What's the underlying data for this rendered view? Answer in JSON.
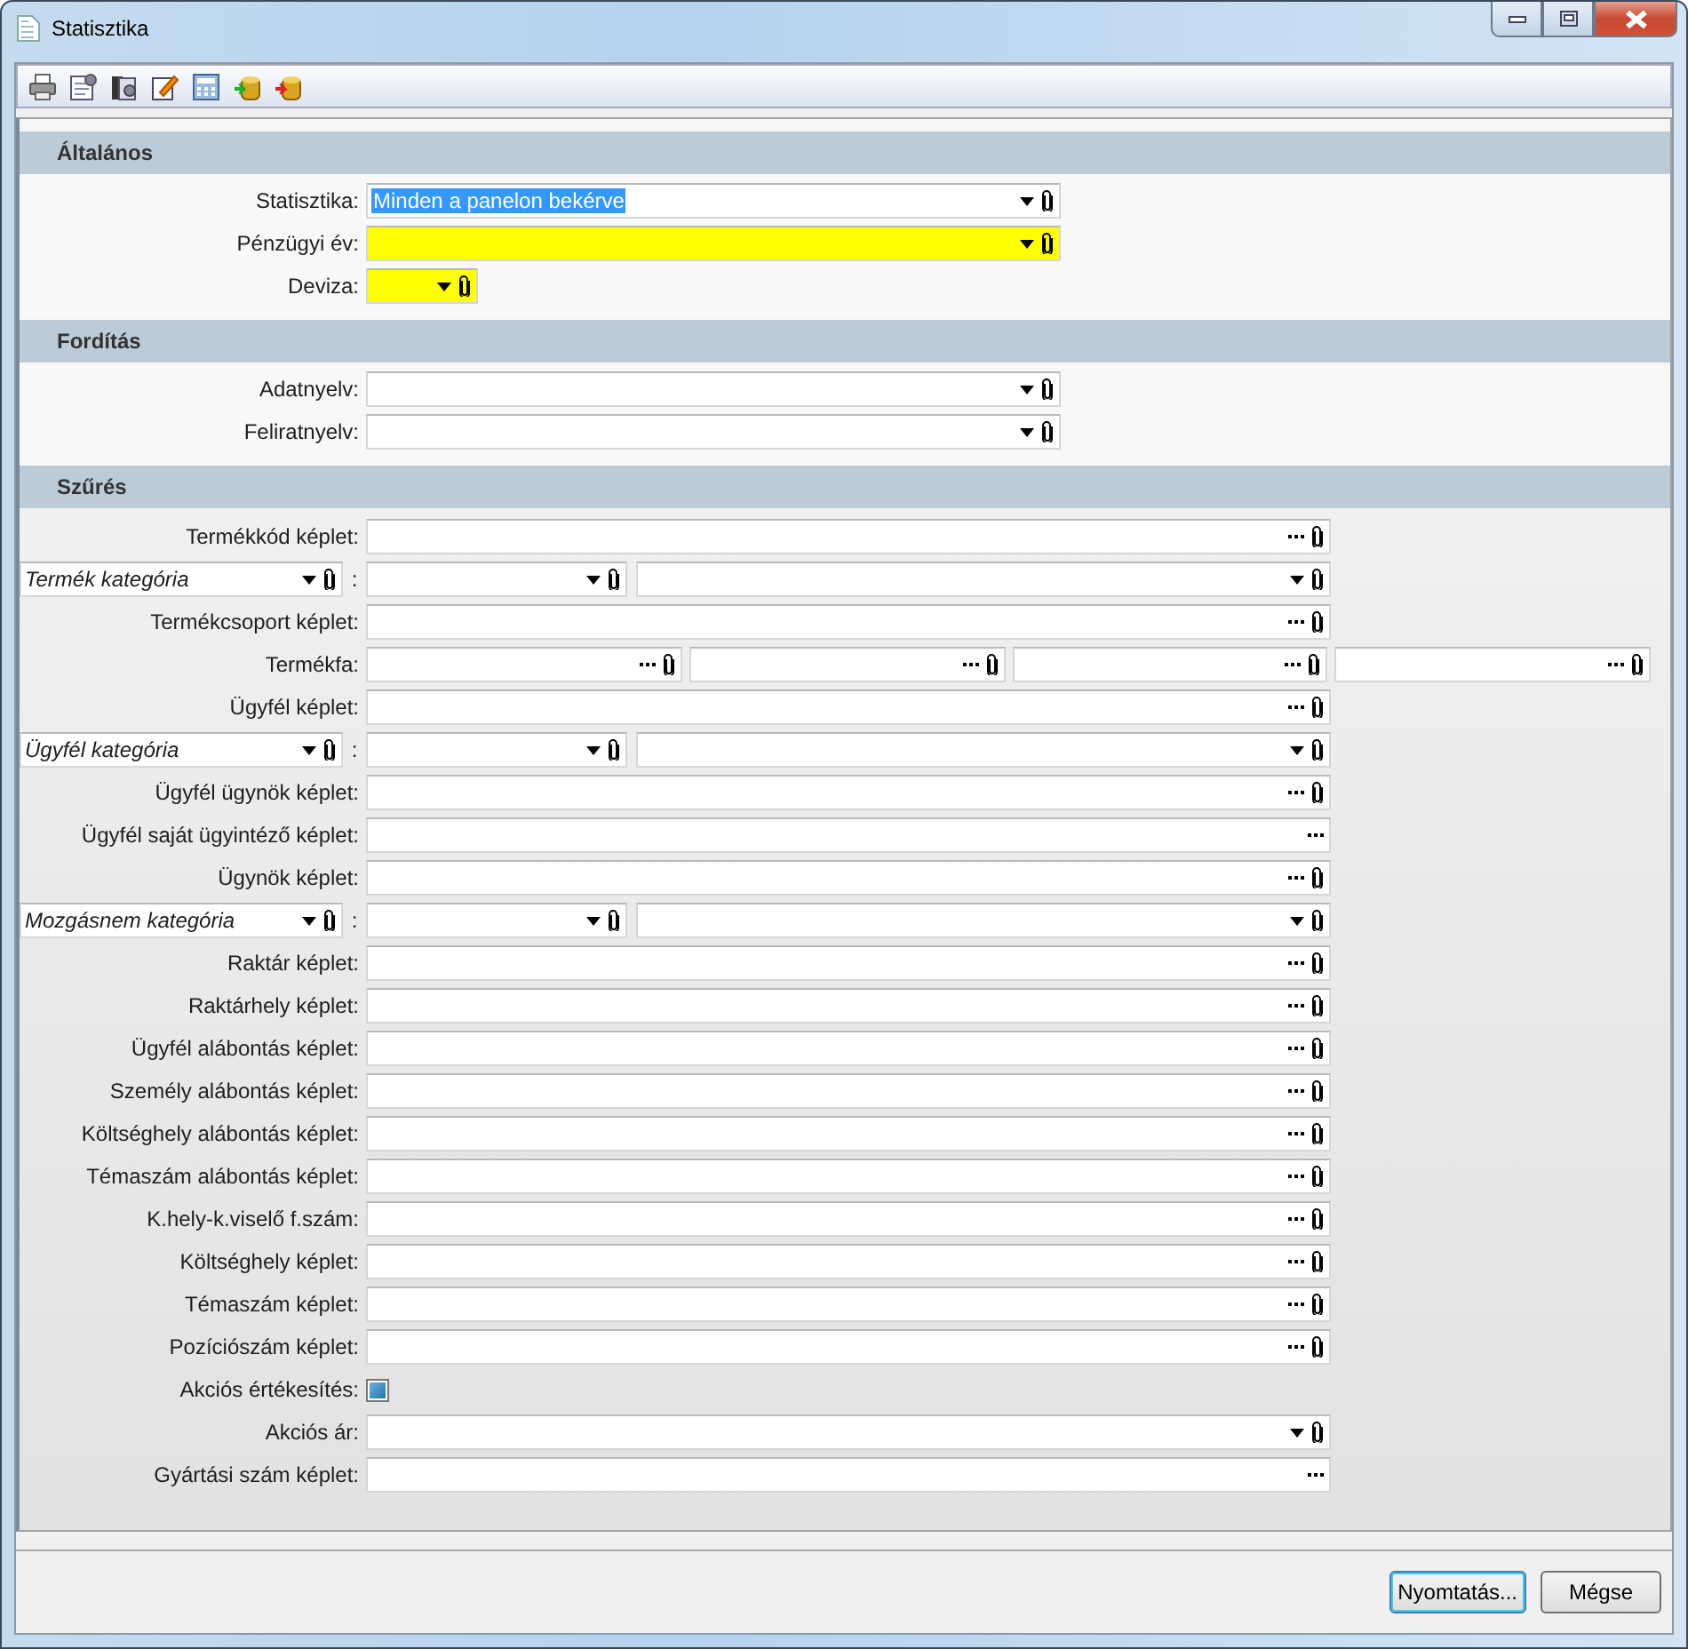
{
  "window": {
    "title": "Statisztika"
  },
  "sections": [
    {
      "title": "Általános",
      "rows": [
        {
          "kind": "combo",
          "label": "Statisztika:",
          "value": "Minden a panelon bekérve",
          "text_selected": true,
          "required": false,
          "clip": true
        },
        {
          "kind": "combo",
          "label": "Pénzügyi év:",
          "required": true,
          "clip": true
        },
        {
          "kind": "small_combo",
          "label": "Deviza:",
          "required": true,
          "clip": true
        }
      ]
    },
    {
      "title": "Fordítás",
      "rows": [
        {
          "kind": "combo",
          "label": "Adatnyelv:",
          "required": false,
          "clip": true
        },
        {
          "kind": "combo",
          "label": "Feliratnyelv:",
          "required": false,
          "clip": true
        }
      ]
    },
    {
      "title": "Szűrés",
      "rows": [
        {
          "kind": "formula",
          "label": "Termékkód képlet:",
          "required": false,
          "clip": true
        },
        {
          "kind": "category",
          "value": "Termék kategória",
          "separator": ":"
        },
        {
          "kind": "formula",
          "label": "Termékcsoport képlet:",
          "required": false,
          "clip": true
        },
        {
          "kind": "tree",
          "label": "Termékfa:",
          "fields": [
            {
              "clip": true
            },
            {
              "clip": true
            },
            {
              "clip": true
            },
            {
              "clip": true
            }
          ]
        },
        {
          "kind": "formula",
          "label": "Ügyfél képlet:",
          "required": false,
          "clip": true
        },
        {
          "kind": "category",
          "value": "Ügyfél kategória",
          "separator": ":"
        },
        {
          "kind": "formula",
          "label": "Ügyfél ügynök képlet:",
          "required": false,
          "clip": true
        },
        {
          "kind": "formula",
          "label": "Ügyfél saját ügyintéző képlet:",
          "required": false,
          "clip": false
        },
        {
          "kind": "formula",
          "label": "Ügynök képlet:",
          "required": false,
          "clip": true
        },
        {
          "kind": "category",
          "value": "Mozgásnem kategória",
          "separator": ":"
        },
        {
          "kind": "formula",
          "label": "Raktár képlet:",
          "required": false,
          "clip": true
        },
        {
          "kind": "formula",
          "label": "Raktárhely képlet:",
          "required": false,
          "clip": true
        },
        {
          "kind": "formula",
          "label": "Ügyfél alábontás képlet:",
          "required": false,
          "clip": true
        },
        {
          "kind": "formula",
          "label": "Személy alábontás képlet:",
          "required": false,
          "clip": true
        },
        {
          "kind": "formula",
          "label": "Költséghely alábontás képlet:",
          "required": false,
          "clip": true
        },
        {
          "kind": "formula",
          "label": "Témaszám alábontás képlet:",
          "required": false,
          "clip": true
        },
        {
          "kind": "formula",
          "label": "K.hely-k.viselő f.szám:",
          "required": false,
          "clip": true
        },
        {
          "kind": "formula",
          "label": "Költséghely képlet:",
          "required": false,
          "clip": true
        },
        {
          "kind": "formula",
          "label": "Témaszám képlet:",
          "required": false,
          "clip": true
        },
        {
          "kind": "formula",
          "label": "Pozíciószám képlet:",
          "required": false,
          "clip": true
        },
        {
          "kind": "checkbox",
          "label": "Akciós értékesítés:",
          "checked": true
        },
        {
          "kind": "wide_combo",
          "label": "Akciós ár:",
          "required": false,
          "clip": true
        },
        {
          "kind": "formula",
          "label": "Gyártási szám képlet:",
          "required": false,
          "clip": false
        }
      ]
    }
  ],
  "buttons": [
    {
      "label": "Nyomtatás...",
      "default": true
    },
    {
      "label": "Mégse",
      "default": false
    }
  ]
}
